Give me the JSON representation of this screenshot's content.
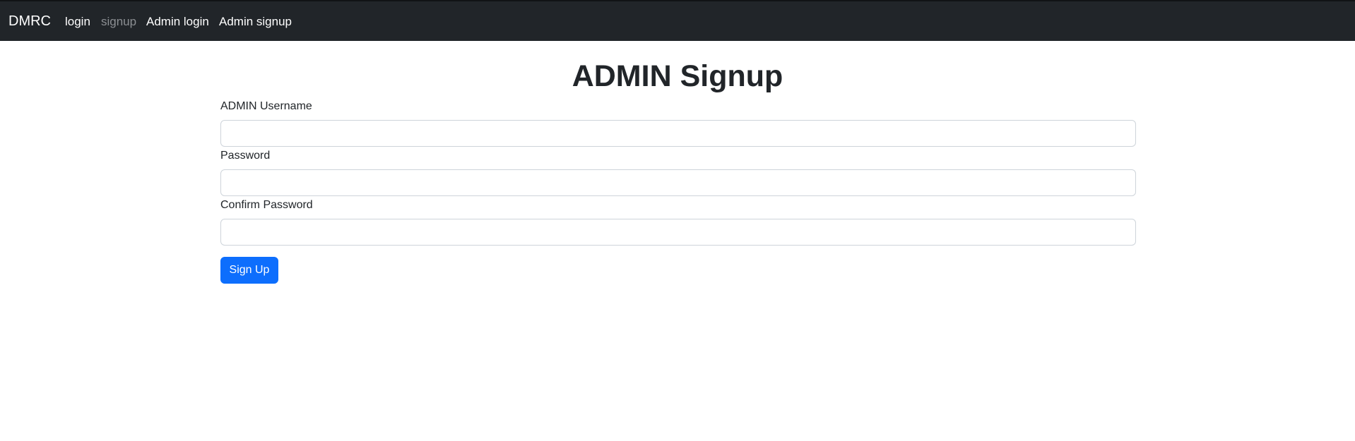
{
  "navbar": {
    "brand": "DMRC",
    "links": [
      {
        "label": "login",
        "active": true
      },
      {
        "label": "signup",
        "active": false
      },
      {
        "label": "Admin login",
        "active": true
      },
      {
        "label": "Admin signup",
        "active": true
      }
    ]
  },
  "main": {
    "title": "ADMIN Signup",
    "fields": {
      "username": {
        "label": "ADMIN Username",
        "value": "",
        "placeholder": ""
      },
      "password": {
        "label": "Password",
        "value": "",
        "placeholder": ""
      },
      "confirm_password": {
        "label": "Confirm Password",
        "value": "",
        "placeholder": ""
      }
    },
    "submit_label": "Sign Up"
  },
  "colors": {
    "navbar_bg": "#212529",
    "primary": "#0d6efd",
    "muted_link": "#8c8f93"
  }
}
